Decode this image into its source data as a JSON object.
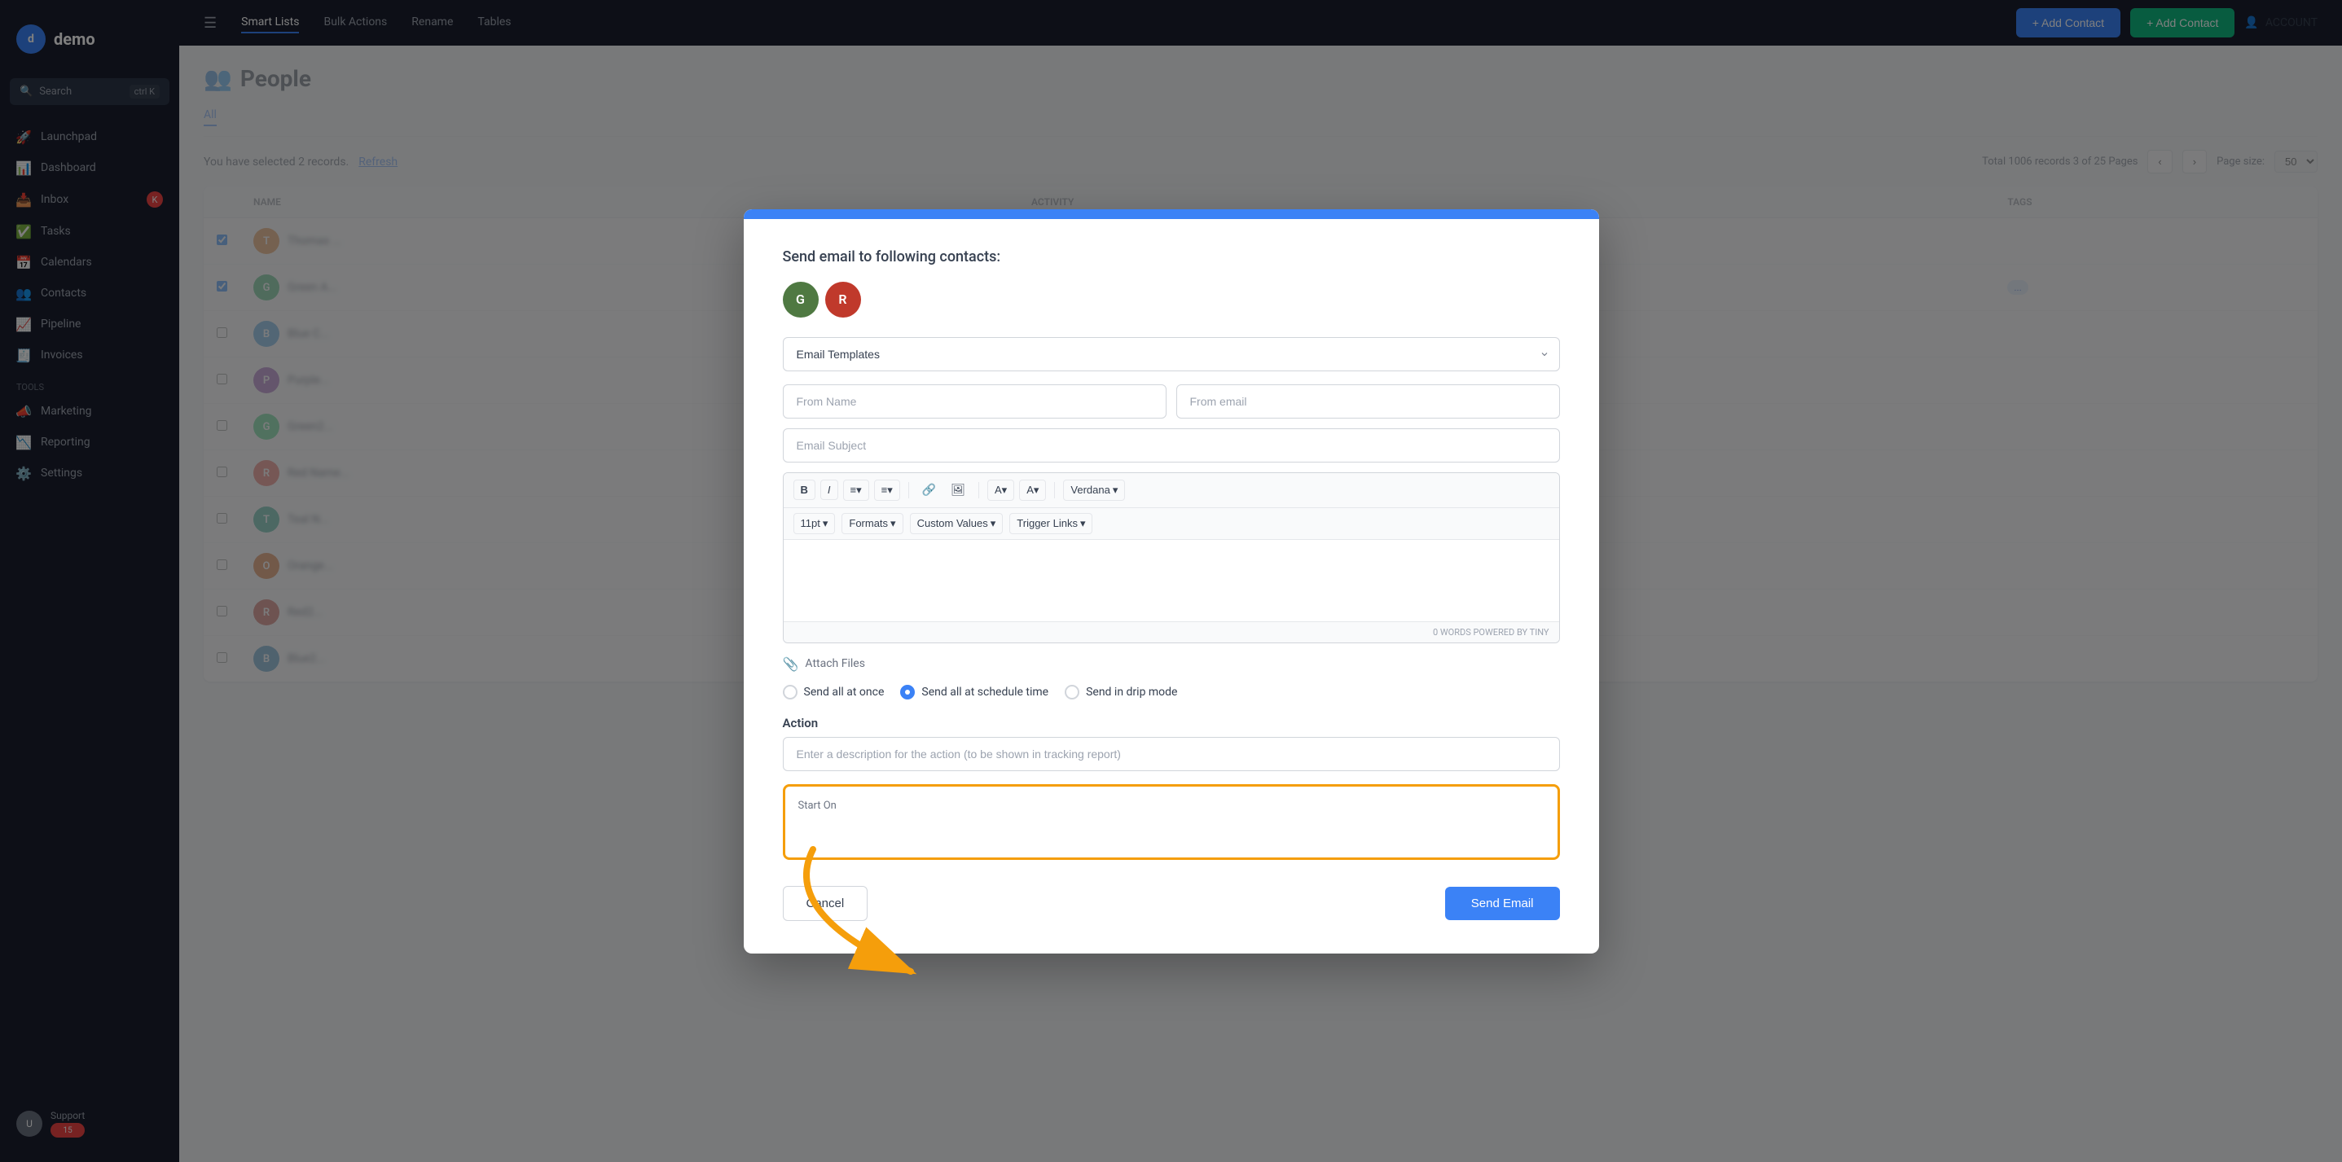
{
  "app": {
    "logo_text": "demo",
    "logo_initial": "d"
  },
  "sidebar": {
    "search_placeholder": "Search",
    "search_shortcut": "ctrl K",
    "items": [
      {
        "id": "launchpad",
        "label": "Launchpad",
        "icon": "🚀"
      },
      {
        "id": "dashboard",
        "label": "Dashboard",
        "icon": "📊"
      },
      {
        "id": "inbox",
        "label": "Inbox",
        "icon": "📥",
        "badge": "K"
      },
      {
        "id": "tasks",
        "label": "Tasks",
        "icon": "✅"
      },
      {
        "id": "calendars",
        "label": "Calendars",
        "icon": "📅"
      },
      {
        "id": "contacts",
        "label": "Contacts",
        "icon": "👥"
      },
      {
        "id": "pipeline",
        "label": "Pipeline",
        "icon": "📈"
      },
      {
        "id": "invoices",
        "label": "Invoices",
        "icon": "🧾"
      },
      {
        "id": "marketing",
        "label": "Marketing",
        "icon": "📣"
      },
      {
        "id": "reporting",
        "label": "Reporting",
        "icon": "📉"
      },
      {
        "id": "settings",
        "label": "Settings",
        "icon": "⚙️"
      }
    ],
    "support_badge": "15"
  },
  "top_nav": {
    "items": [
      {
        "id": "smart-lists",
        "label": "Smart Lists",
        "active": true
      },
      {
        "id": "bulk-actions",
        "label": "Bulk Actions"
      },
      {
        "id": "rename",
        "label": "Rename"
      },
      {
        "id": "tables",
        "label": "Tables"
      }
    ]
  },
  "people": {
    "title": "People",
    "icon": "👥",
    "header_btn1": "+ Add Contact",
    "header_btn2": "+ Add Contact",
    "user_label": "ACCOUNT",
    "sub_nav": [
      "All"
    ],
    "selection_text": "You have selected 2 records.",
    "refresh_text": "Refresh",
    "columns": [
      "Name",
      "Activity",
      "Tags"
    ],
    "pagination": {
      "total_text": "Total 1006 records 3 of 25 Pages",
      "page_size_label": "Page size:",
      "page_size": "50"
    }
  },
  "modal": {
    "header_color": "#4472c4",
    "title": "Send email to following contacts:",
    "contacts": [
      {
        "initial": "G",
        "color": "#4f7942"
      },
      {
        "initial": "R",
        "color": "#c0392b"
      }
    ],
    "template_select": {
      "placeholder": "Email Templates",
      "options": [
        "Email Templates"
      ]
    },
    "from_name_placeholder": "From Name",
    "from_email_placeholder": "From email",
    "subject_placeholder": "Email Subject",
    "editor": {
      "toolbar_row1": {
        "bold": "B",
        "italic": "I",
        "bullet_list": "≡",
        "numbered_list": "≡",
        "link": "🔗",
        "image": "🖼",
        "text_color": "A",
        "highlight": "A",
        "font": "Verdana"
      },
      "toolbar_row2": {
        "font_size": "11pt",
        "formats": "Formats",
        "custom_values": "Custom Values",
        "trigger_links": "Trigger Links"
      },
      "footer_text": "0 WORDS POWERED BY TINY"
    },
    "attach_files_label": "Attach Files",
    "send_options": [
      {
        "id": "send-at-once",
        "label": "Send all at once",
        "checked": false
      },
      {
        "id": "send-at-schedule",
        "label": "Send all at schedule time",
        "checked": true
      },
      {
        "id": "send-drip",
        "label": "Send in drip mode",
        "checked": false
      }
    ],
    "action_label": "Action",
    "action_placeholder": "Enter a description for the action (to be shown in tracking report)",
    "start_on_label": "Start On",
    "start_on_value": "",
    "cancel_label": "Cancel",
    "send_label": "Send Email"
  },
  "arrow": {
    "color": "#f59e0b"
  }
}
